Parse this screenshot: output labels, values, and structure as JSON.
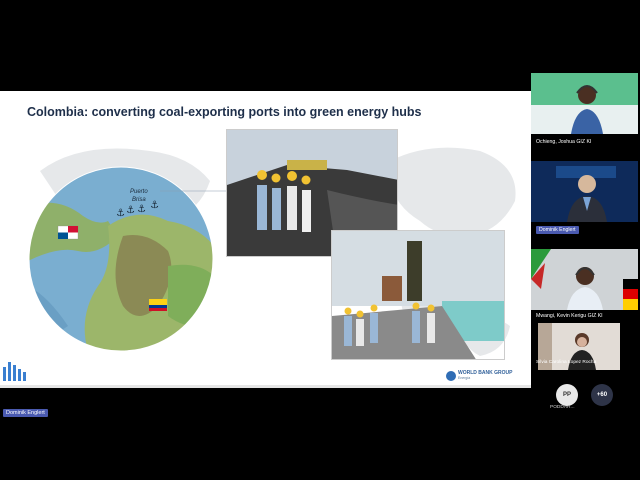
{
  "slide": {
    "title": "Colombia: converting coal-exporting ports into green energy hubs",
    "map_label_line1": "Puerto",
    "map_label_line2": "Brisa",
    "logo_line1": "WORLD BANK GROUP",
    "logo_line2": "Energía"
  },
  "presenter_tag": "Dominik Englert",
  "participants": [
    {
      "name": "Ochieng, Joshua GIZ KI"
    },
    {
      "name": "Dominik Englert"
    },
    {
      "name": "Mwangi, Kevin Kerigu GIZ KI"
    },
    {
      "name": "Silvia Carolina Lopez Rocha"
    }
  ],
  "overflow": {
    "avatar_initials": "PP",
    "avatar_label": "PODDAR...",
    "more_count": "+60"
  },
  "colors": {
    "title": "#1e2f4a",
    "name_badge": "#4a5ab0",
    "tile1_bg": "#5bbf8e",
    "tile2_bg": "#0e2a5a"
  }
}
